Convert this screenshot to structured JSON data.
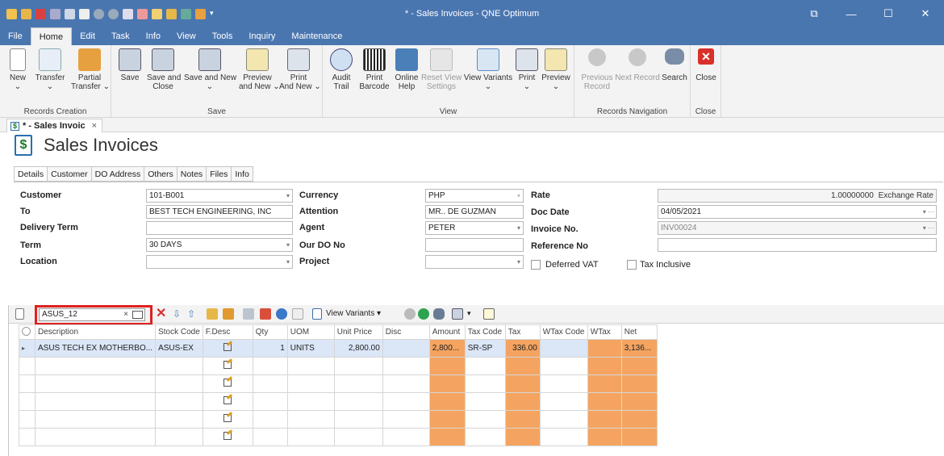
{
  "window": {
    "title": "* - Sales Invoices - QNE Optimum",
    "controls": [
      "restore-icon",
      "minimize-icon",
      "maximize-icon",
      "close-icon"
    ]
  },
  "menu": {
    "tabs": [
      "File",
      "Home",
      "Edit",
      "Task",
      "Info",
      "View",
      "Tools",
      "Inquiry",
      "Maintenance"
    ],
    "active": "Home"
  },
  "ribbon": {
    "groups": [
      {
        "label": "Records Creation",
        "buttons": [
          {
            "label": "New",
            "sub": "⌄",
            "icon": "new-document-icon"
          },
          {
            "label": "Transfer",
            "sub": "⌄",
            "icon": "transfer-icon"
          },
          {
            "label": "Partial",
            "sub": "Transfer ⌄",
            "icon": "partial-transfer-icon"
          }
        ]
      },
      {
        "label": "Save",
        "buttons": [
          {
            "label": "Save",
            "sub": "",
            "icon": "save-icon"
          },
          {
            "label": "Save and",
            "sub": "Close",
            "icon": "save-close-icon"
          },
          {
            "label": "Save and New",
            "sub": "⌄",
            "icon": "save-new-icon"
          },
          {
            "label": "Preview",
            "sub": "and New ⌄",
            "icon": "preview-new-icon"
          },
          {
            "label": "Print",
            "sub": "And New ⌄",
            "icon": "print-new-icon"
          }
        ]
      },
      {
        "label": "View",
        "buttons": [
          {
            "label": "Audit",
            "sub": "Trail",
            "icon": "audit-trail-icon"
          },
          {
            "label": "Print",
            "sub": "Barcode",
            "icon": "barcode-icon"
          },
          {
            "label": "Online",
            "sub": "Help",
            "icon": "help-icon"
          },
          {
            "label": "Reset View",
            "sub": "Settings",
            "icon": "reset-view-icon"
          },
          {
            "label": "View Variants",
            "sub": "⌄",
            "icon": "view-variants-icon"
          },
          {
            "label": "Print",
            "sub": "⌄",
            "icon": "print-icon"
          },
          {
            "label": "Preview",
            "sub": "⌄",
            "icon": "preview-icon"
          }
        ]
      },
      {
        "label": "Records Navigation",
        "buttons": [
          {
            "label": "Previous",
            "sub": "Record",
            "icon": "previous-record-icon"
          },
          {
            "label": "Next Record",
            "sub": "",
            "icon": "next-record-icon"
          },
          {
            "label": "Search",
            "sub": "",
            "icon": "binoculars-icon"
          }
        ]
      },
      {
        "label": "Close",
        "buttons": [
          {
            "label": "Close",
            "sub": "",
            "icon": "close-red-icon"
          }
        ]
      }
    ]
  },
  "doc_tab": {
    "label": "* - Sales Invoic",
    "close": "×"
  },
  "page": {
    "title": "Sales Invoices"
  },
  "form_tabs": [
    "Details",
    "Customer",
    "DO Address",
    "Others",
    "Notes",
    "Files",
    "Info"
  ],
  "form": {
    "customer": {
      "label": "Customer",
      "value": "101-B001"
    },
    "to": {
      "label": "To",
      "value": "BEST TECH ENGINEERING, INC"
    },
    "delivery_term": {
      "label": "Delivery Term",
      "value": ""
    },
    "term": {
      "label": "Term",
      "value": "30 DAYS"
    },
    "location": {
      "label": "Location",
      "value": ""
    },
    "currency": {
      "label": "Currency",
      "value": "PHP"
    },
    "attention": {
      "label": "Attention",
      "value": "MR.. DE GUZMAN"
    },
    "agent": {
      "label": "Agent",
      "value": "PETER"
    },
    "our_do_no": {
      "label": "Our DO No",
      "value": ""
    },
    "project": {
      "label": "Project",
      "value": ""
    },
    "rate": {
      "label": "Rate",
      "value": "1.00000000",
      "suffix": "Exchange Rate"
    },
    "doc_date": {
      "label": "Doc Date",
      "value": "04/05/2021"
    },
    "invoice_no": {
      "label": "Invoice No.",
      "value": "INV00024"
    },
    "reference_no": {
      "label": "Reference No",
      "value": ""
    },
    "deferred_vat": {
      "label": "Deferred VAT",
      "checked": false
    },
    "tax_inclusive": {
      "label": "Tax Inclusive",
      "checked": false
    }
  },
  "grid_toolbar": {
    "search_value": "ASUS_12",
    "clear": "×",
    "view_variants": "View Variants ▾"
  },
  "grid": {
    "columns": [
      "Description",
      "Stock Code",
      "F.Desc",
      "Qty",
      "UOM",
      "Unit Price",
      "Disc",
      "Amount",
      "Tax Code",
      "Tax",
      "WTax Code",
      "WTax",
      "Net"
    ],
    "rows": [
      [
        "ASUS TECH EX MOTHERBO...",
        "ASUS-EX",
        "",
        "1",
        "UNITS",
        "2,800.00",
        "",
        "2,800...",
        "SR-SP",
        "336.00",
        "",
        "",
        "3,136..."
      ]
    ],
    "empty_rows": 5
  },
  "colors": {
    "titlebar": "#4a76b0",
    "orange_cell": "#f4a460",
    "selected_row": "#dbe6f7",
    "highlight": "#e02020"
  }
}
